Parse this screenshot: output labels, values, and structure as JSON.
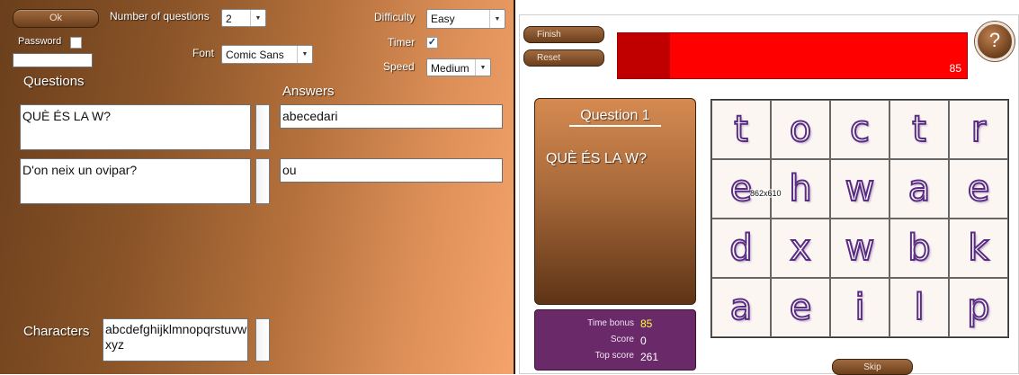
{
  "editor": {
    "ok_label": "Ok",
    "num_questions_label": "Number of questions",
    "num_questions_value": "2",
    "password_label": "Password",
    "password_checked": false,
    "password_value": "",
    "font_label": "Font",
    "font_value": "Comic Sans",
    "difficulty_label": "Difficulty",
    "difficulty_value": "Easy",
    "timer_label": "Timer",
    "timer_checked": true,
    "timer_mark": "✓",
    "speed_label": "Speed",
    "speed_value": "Medium",
    "questions_header": "Questions",
    "answers_header": "Answers",
    "questions": [
      "QUÈ ÉS LA W?",
      "D'on neix un ovipar?"
    ],
    "answers": [
      "abecedari",
      "ou"
    ],
    "characters_label": "Characters",
    "characters_value": "abcdefghijklmnopqrstuvwxyz"
  },
  "game": {
    "finish_label": "Finish",
    "reset_label": "Reset",
    "help_label": "?",
    "timer_value": "85",
    "timer_fraction": 0.15,
    "question_title": "Question 1",
    "question_text": "QUÈ ÉS LA W?",
    "overlay_text": "862x610",
    "grid_letters": [
      [
        "t",
        "o",
        "c",
        "t",
        "r"
      ],
      [
        "e",
        "h",
        "w",
        "a",
        "e"
      ],
      [
        "d",
        "x",
        "w",
        "b",
        "k"
      ],
      [
        "a",
        "e",
        "i",
        "l",
        "p"
      ]
    ],
    "time_bonus_label": "Time bonus",
    "time_bonus_value": "85",
    "score_label": "Score",
    "score_value": "0",
    "top_score_label": "Top score",
    "top_score_value": "261",
    "skip_label": "Skip"
  },
  "colors": {
    "timer_bar": "#ff0000",
    "timer_fill": "#c00000",
    "score_panel": "#6a2a6a",
    "time_bonus_value": "#ffff33",
    "letter_outline": "#5a2d82"
  }
}
